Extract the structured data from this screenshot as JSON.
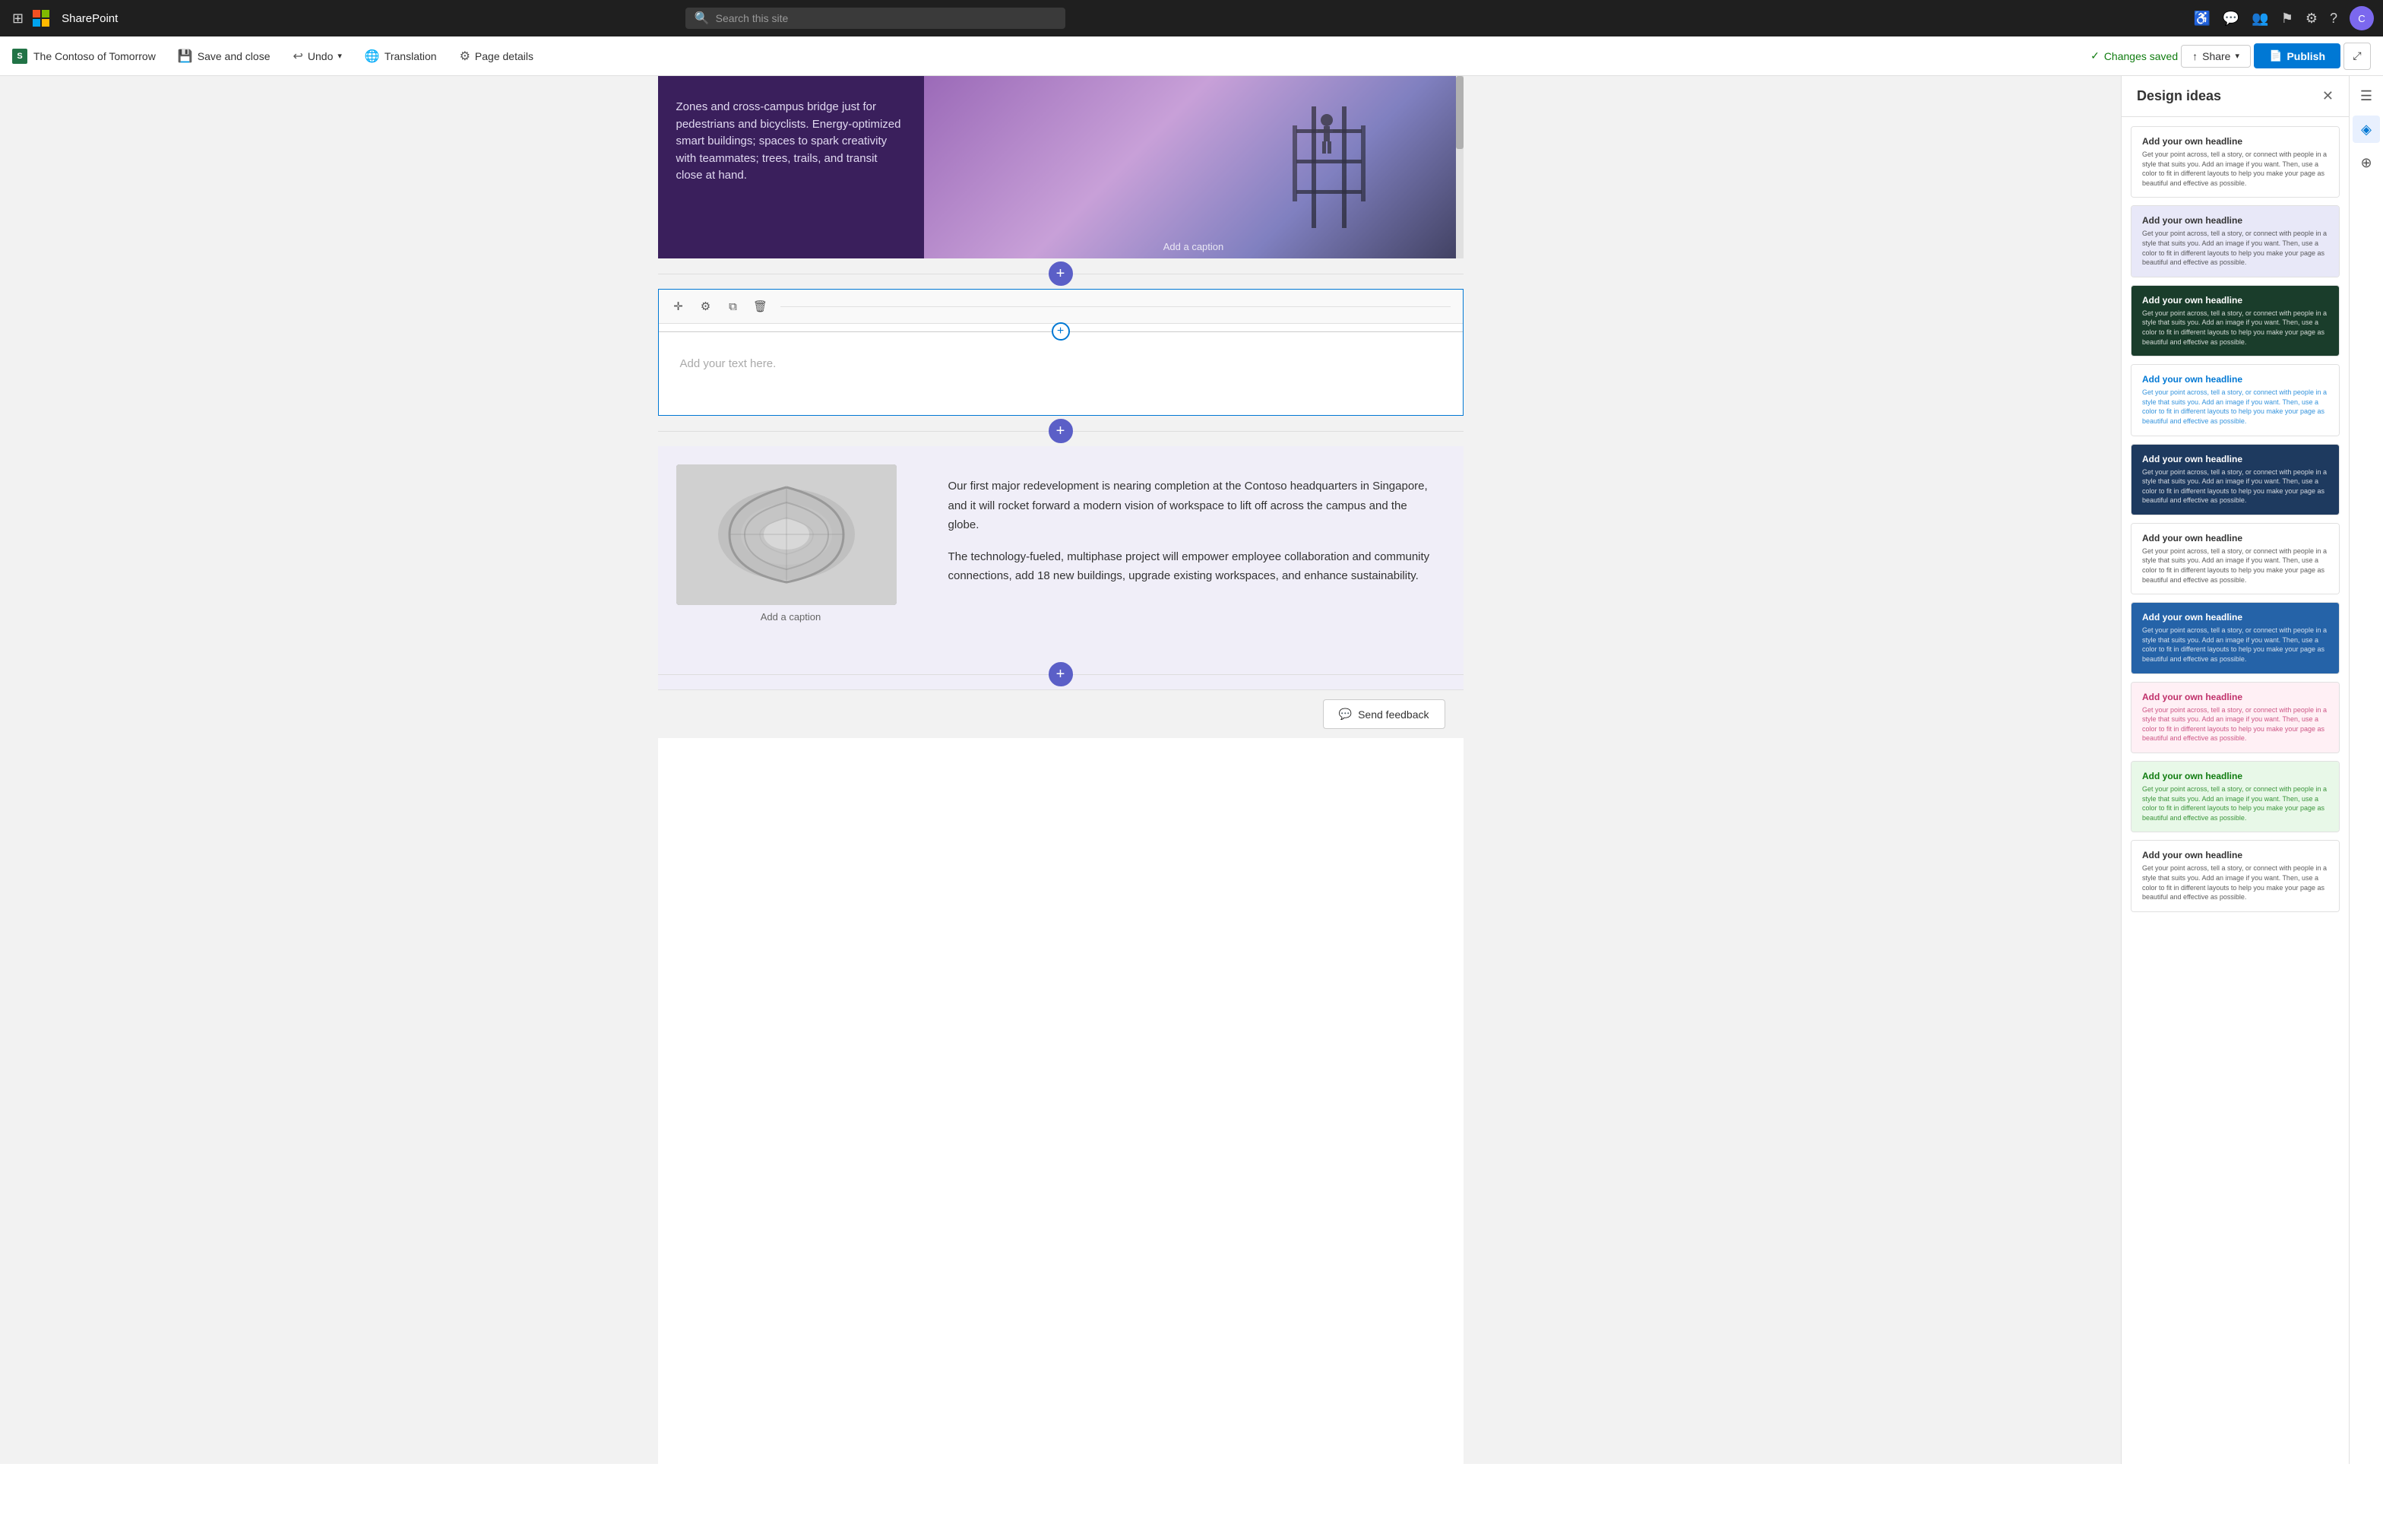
{
  "topNav": {
    "appName": "SharePoint",
    "searchPlaceholder": "Search this site",
    "navIcons": [
      "accessibility-icon",
      "chat-icon",
      "people-icon",
      "flag-icon",
      "settings-icon",
      "help-icon"
    ]
  },
  "toolbar": {
    "brandIcon": "SP",
    "brandLabel": "The Contoso of Tomorrow",
    "saveAndClose": "Save and close",
    "undoLabel": "Undo",
    "translationLabel": "Translation",
    "pageDetailsLabel": "Page details",
    "changesSaved": "Changes saved",
    "shareLabel": "Share",
    "publishLabel": "Publish"
  },
  "editor": {
    "topTextContent": "Zones and cross-campus bridge just for pedestrians and bicyclists. Energy-optimized smart buildings; spaces to spark creativity with teammates; trees, trails, and transit close at hand.",
    "imageCaptionTop": "Add a caption",
    "editablePlaceholder": "Add your text here.",
    "bottomParagraph1": "Our first major redevelopment is nearing completion at the Contoso headquarters in Singapore, and it will rocket forward a modern vision of workspace to lift off across the campus and the globe.",
    "bottomParagraph2": "The technology-fueled, multiphase project will empower employee collaboration and community connections, add 18 new buildings, upgrade existing workspaces, and enhance sustainability.",
    "imageCaptionBottom": "Add a caption",
    "sendFeedback": "Send feedback"
  },
  "designIdeas": {
    "panelTitle": "Design ideas",
    "ideas": [
      {
        "bg": "#ffffff",
        "textColor": "#333",
        "accent": "#f0f0f0",
        "headline": "Add your own headline",
        "subtext": "Get your point across, tell a story, or connect with people in a style that suits you. Add an image if you want. Then, use a color to fit in different layouts to help you make your page as beautiful and effective as possible."
      },
      {
        "bg": "#e8e8f8",
        "textColor": "#333",
        "accent": "#d0d0e8",
        "headline": "Add your own headline",
        "subtext": "Get your point across, tell a story, or connect with people in a style that suits you. Add an image if you want. Then, use a color to fit in different layouts to help you make your page as beautiful and effective as possible."
      },
      {
        "bg": "#1a3d2b",
        "textColor": "#ffffff",
        "accent": "#2d6040",
        "headline": "Add your own headline",
        "subtext": "Get your point across, tell a story, or connect with people in a style that suits you. Add an image if you want. Then, use a color to fit in different layouts to help you make your page as beautiful and effective as possible."
      },
      {
        "bg": "#ffffff",
        "textColor": "#0078d4",
        "accent": "#f0f0f0",
        "headline": "Add your own headline",
        "subtext": "Get your point across, tell a story, or connect with people in a style that suits you. Add an image if you want. Then, use a color to fit in different layouts to help you make your page as beautiful and effective as possible."
      },
      {
        "bg": "#1e3a5f",
        "textColor": "#ffffff",
        "accent": "#2a4a6f",
        "headline": "Add your own headline",
        "subtext": "Get your point across, tell a story, or connect with people in a style that suits you. Add an image if you want. Then, use a color to fit in different layouts to help you make your page as beautiful and effective as possible."
      },
      {
        "bg": "#ffffff",
        "textColor": "#333",
        "accent": "#f5f5f5",
        "headline": "Add your own headline",
        "subtext": "Get your point across, tell a story, or connect with people in a style that suits you. Add an image if you want. Then, use a color to fit in different layouts to help you make your page as beautiful and effective as possible."
      },
      {
        "bg": "#2563a8",
        "textColor": "#ffffff",
        "accent": "#3070b8",
        "headline": "Add your own headline",
        "subtext": "Get your point across, tell a story, or connect with people in a style that suits you. Add an image if you want. Then, use a color to fit in different layouts to help you make your page as beautiful and effective as possible."
      },
      {
        "bg": "#fff0f5",
        "textColor": "#c0306a",
        "accent": "#ffe0ec",
        "headline": "Add your own headline",
        "subtext": "Get your point across, tell a story, or connect with people in a style that suits you. Add an image if you want. Then, use a color to fit in different layouts to help you make your page as beautiful and effective as possible."
      },
      {
        "bg": "#e8f8e8",
        "textColor": "#107c10",
        "accent": "#d0f0d0",
        "headline": "Add your own headline",
        "subtext": "Get your point across, tell a story, or connect with people in a style that suits you. Add an image if you want. Then, use a color to fit in different layouts to help you make your page as beautiful and effective as possible."
      },
      {
        "bg": "#ffffff",
        "textColor": "#333",
        "accent": "#f0f0f0",
        "headline": "Add your own headline",
        "subtext": "Get your point across, tell a story, or connect with people in a style that suits you. Add an image if you want. Then, use a color to fit in different layouts to help you make your page as beautiful and effective as possible."
      }
    ]
  }
}
